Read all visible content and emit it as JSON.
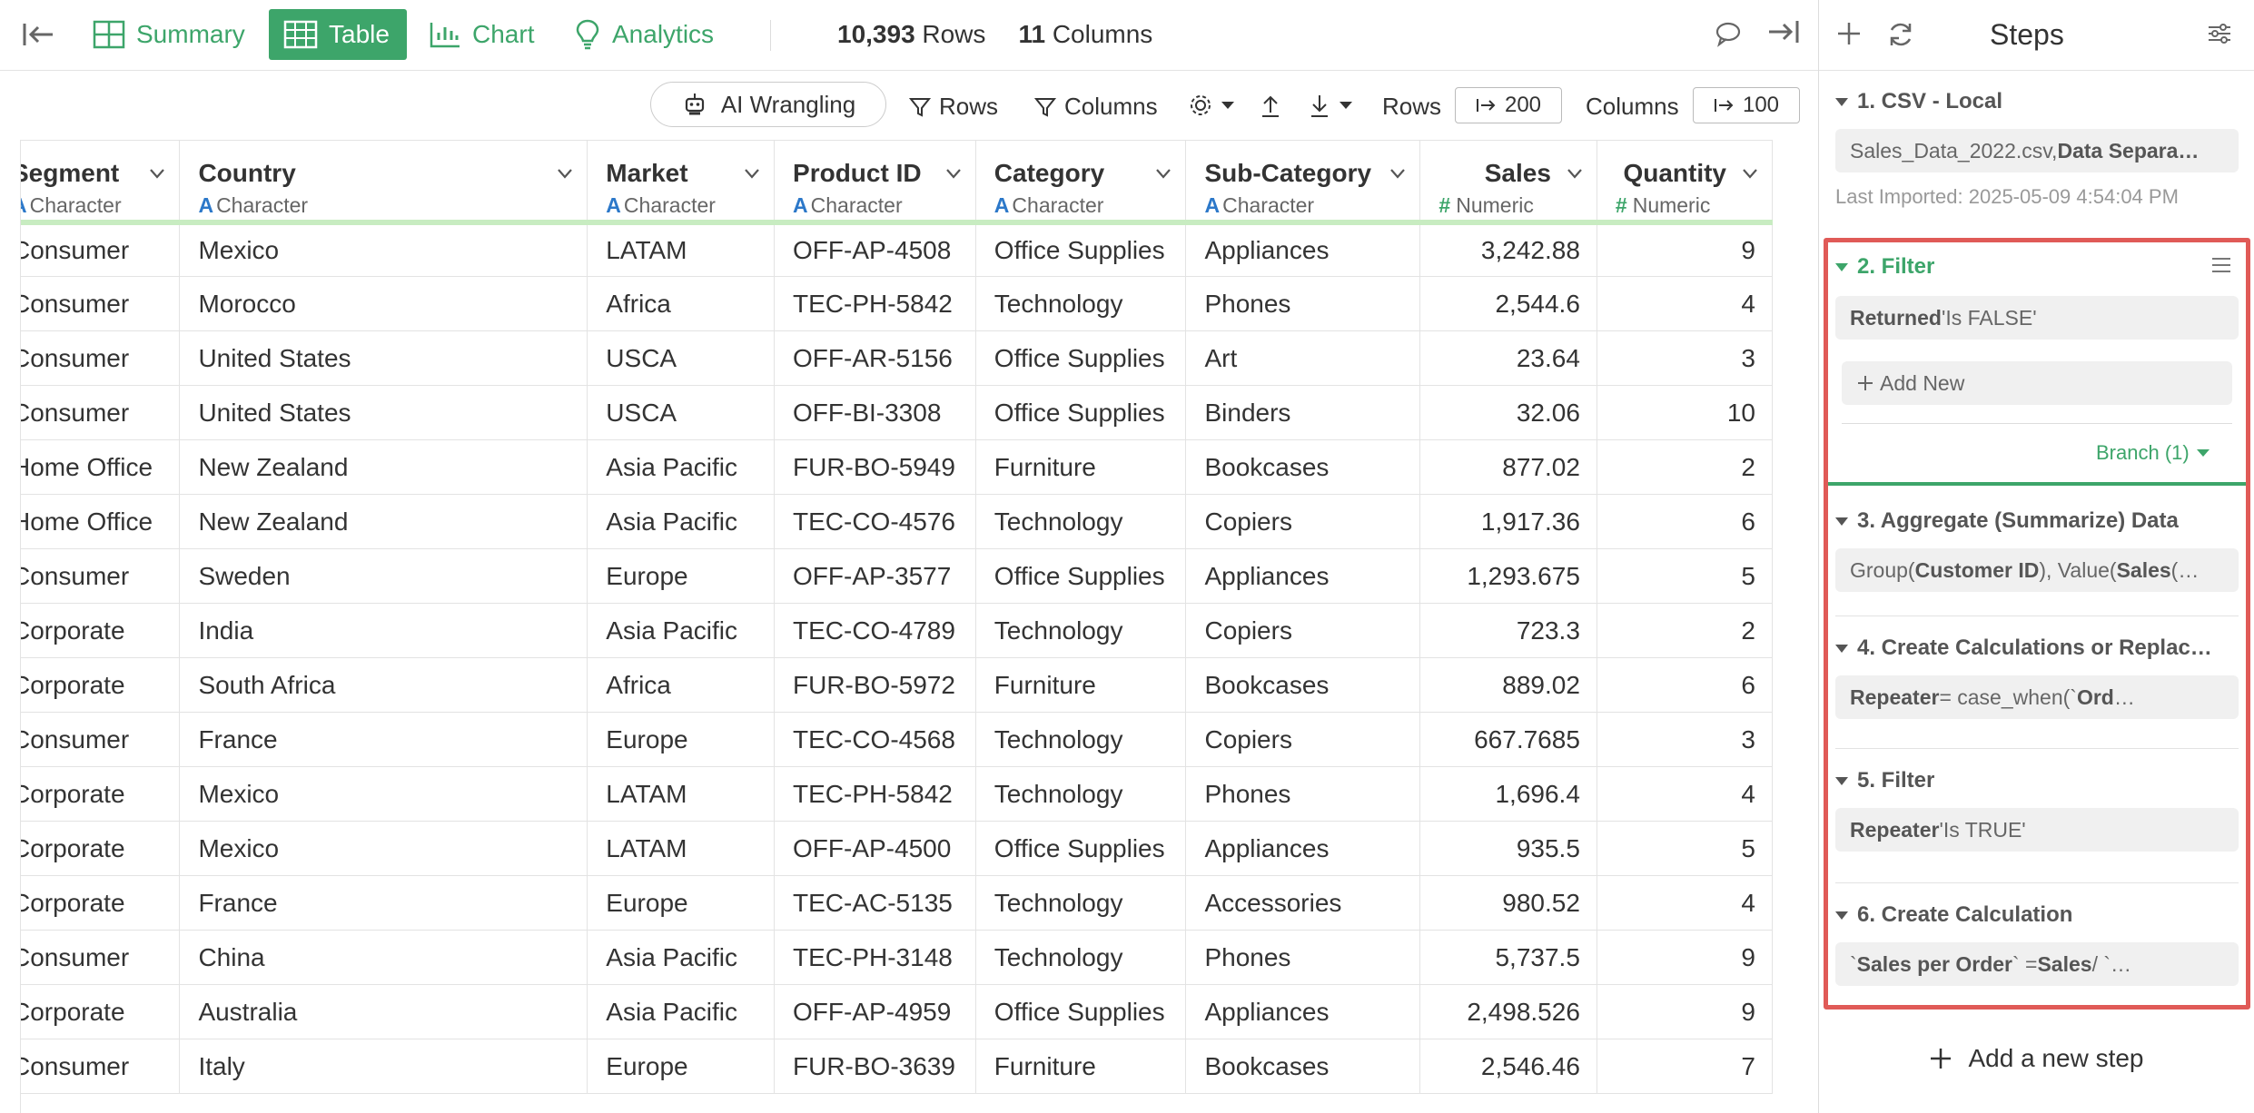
{
  "nav": {
    "tabs": [
      {
        "label": "Summary",
        "icon": "summary-icon"
      },
      {
        "label": "Table",
        "icon": "table-icon",
        "active": true
      },
      {
        "label": "Chart",
        "icon": "chart-icon"
      },
      {
        "label": "Analytics",
        "icon": "bulb-icon"
      }
    ],
    "rows_count": "10,393",
    "rows_label": "Rows",
    "cols_count": "11",
    "cols_label": "Columns"
  },
  "toolbar": {
    "ai_label": "AI Wrangling",
    "rows_filter": "Rows",
    "cols_filter": "Columns",
    "rows_label": "Rows",
    "rows_limit": "200",
    "cols_label": "Columns",
    "cols_limit": "100"
  },
  "table": {
    "columns": [
      {
        "name": "Segment",
        "type": "Character"
      },
      {
        "name": "Country",
        "type": "Character"
      },
      {
        "name": "Market",
        "type": "Character"
      },
      {
        "name": "Product ID",
        "type": "Character"
      },
      {
        "name": "Category",
        "type": "Character"
      },
      {
        "name": "Sub-Category",
        "type": "Character"
      },
      {
        "name": "Sales",
        "type": "Numeric"
      },
      {
        "name": "Quantity",
        "type": "Numeric"
      }
    ],
    "rows": [
      [
        "Consumer",
        "Mexico",
        "LATAM",
        "OFF-AP-4508",
        "Office Supplies",
        "Appliances",
        "3,242.88",
        "9"
      ],
      [
        "Consumer",
        "Morocco",
        "Africa",
        "TEC-PH-5842",
        "Technology",
        "Phones",
        "2,544.6",
        "4"
      ],
      [
        "Consumer",
        "United States",
        "USCA",
        "OFF-AR-5156",
        "Office Supplies",
        "Art",
        "23.64",
        "3"
      ],
      [
        "Consumer",
        "United States",
        "USCA",
        "OFF-BI-3308",
        "Office Supplies",
        "Binders",
        "32.06",
        "10"
      ],
      [
        "Home Office",
        "New Zealand",
        "Asia Pacific",
        "FUR-BO-5949",
        "Furniture",
        "Bookcases",
        "877.02",
        "2"
      ],
      [
        "Home Office",
        "New Zealand",
        "Asia Pacific",
        "TEC-CO-4576",
        "Technology",
        "Copiers",
        "1,917.36",
        "6"
      ],
      [
        "Consumer",
        "Sweden",
        "Europe",
        "OFF-AP-3577",
        "Office Supplies",
        "Appliances",
        "1,293.675",
        "5"
      ],
      [
        "Corporate",
        "India",
        "Asia Pacific",
        "TEC-CO-4789",
        "Technology",
        "Copiers",
        "723.3",
        "2"
      ],
      [
        "Corporate",
        "South Africa",
        "Africa",
        "FUR-BO-5972",
        "Furniture",
        "Bookcases",
        "889.02",
        "6"
      ],
      [
        "Consumer",
        "France",
        "Europe",
        "TEC-CO-4568",
        "Technology",
        "Copiers",
        "667.7685",
        "3"
      ],
      [
        "Corporate",
        "Mexico",
        "LATAM",
        "TEC-PH-5842",
        "Technology",
        "Phones",
        "1,696.4",
        "4"
      ],
      [
        "Corporate",
        "Mexico",
        "LATAM",
        "OFF-AP-4500",
        "Office Supplies",
        "Appliances",
        "935.5",
        "5"
      ],
      [
        "Corporate",
        "France",
        "Europe",
        "TEC-AC-5135",
        "Technology",
        "Accessories",
        "980.52",
        "4"
      ],
      [
        "Consumer",
        "China",
        "Asia Pacific",
        "TEC-PH-3148",
        "Technology",
        "Phones",
        "5,737.5",
        "9"
      ],
      [
        "Corporate",
        "Australia",
        "Asia Pacific",
        "OFF-AP-4959",
        "Office Supplies",
        "Appliances",
        "2,498.526",
        "9"
      ],
      [
        "Consumer",
        "Italy",
        "Europe",
        "FUR-BO-3639",
        "Furniture",
        "Bookcases",
        "2,546.46",
        "7"
      ]
    ]
  },
  "steps": {
    "title": "Steps",
    "items": [
      {
        "title": "1. CSV - Local",
        "chip_plain": "Sales_Data_2022.csv, ",
        "chip_bold": "Data Separa…",
        "imported": "Last Imported: 2025-05-09 4:54:04 PM"
      },
      {
        "title": "2. Filter",
        "chip_bold": "Returned",
        "chip_plain": " 'Is FALSE'",
        "add_new": "Add New",
        "branch": "Branch (1)"
      },
      {
        "title": "3. Aggregate (Summarize) Data",
        "chip_html": "Group(<b>Customer ID</b>), Value(<b>Sales</b> (…"
      },
      {
        "title": "4. Create Calculations or Replac…",
        "chip_html": "<b>Repeater</b> = case_when(`<b>Ord</b>…"
      },
      {
        "title": "5. Filter",
        "chip_bold": "Repeater",
        "chip_plain": " 'Is TRUE'"
      },
      {
        "title": "6. Create Calculation",
        "chip_html": "`<b>Sales per Order</b>` = <b>Sales</b> / `…"
      }
    ],
    "add_step": "Add a new step"
  },
  "colors": {
    "accent": "#3da56a",
    "highlight": "#e05a57",
    "char_type": "#2c78c9"
  }
}
